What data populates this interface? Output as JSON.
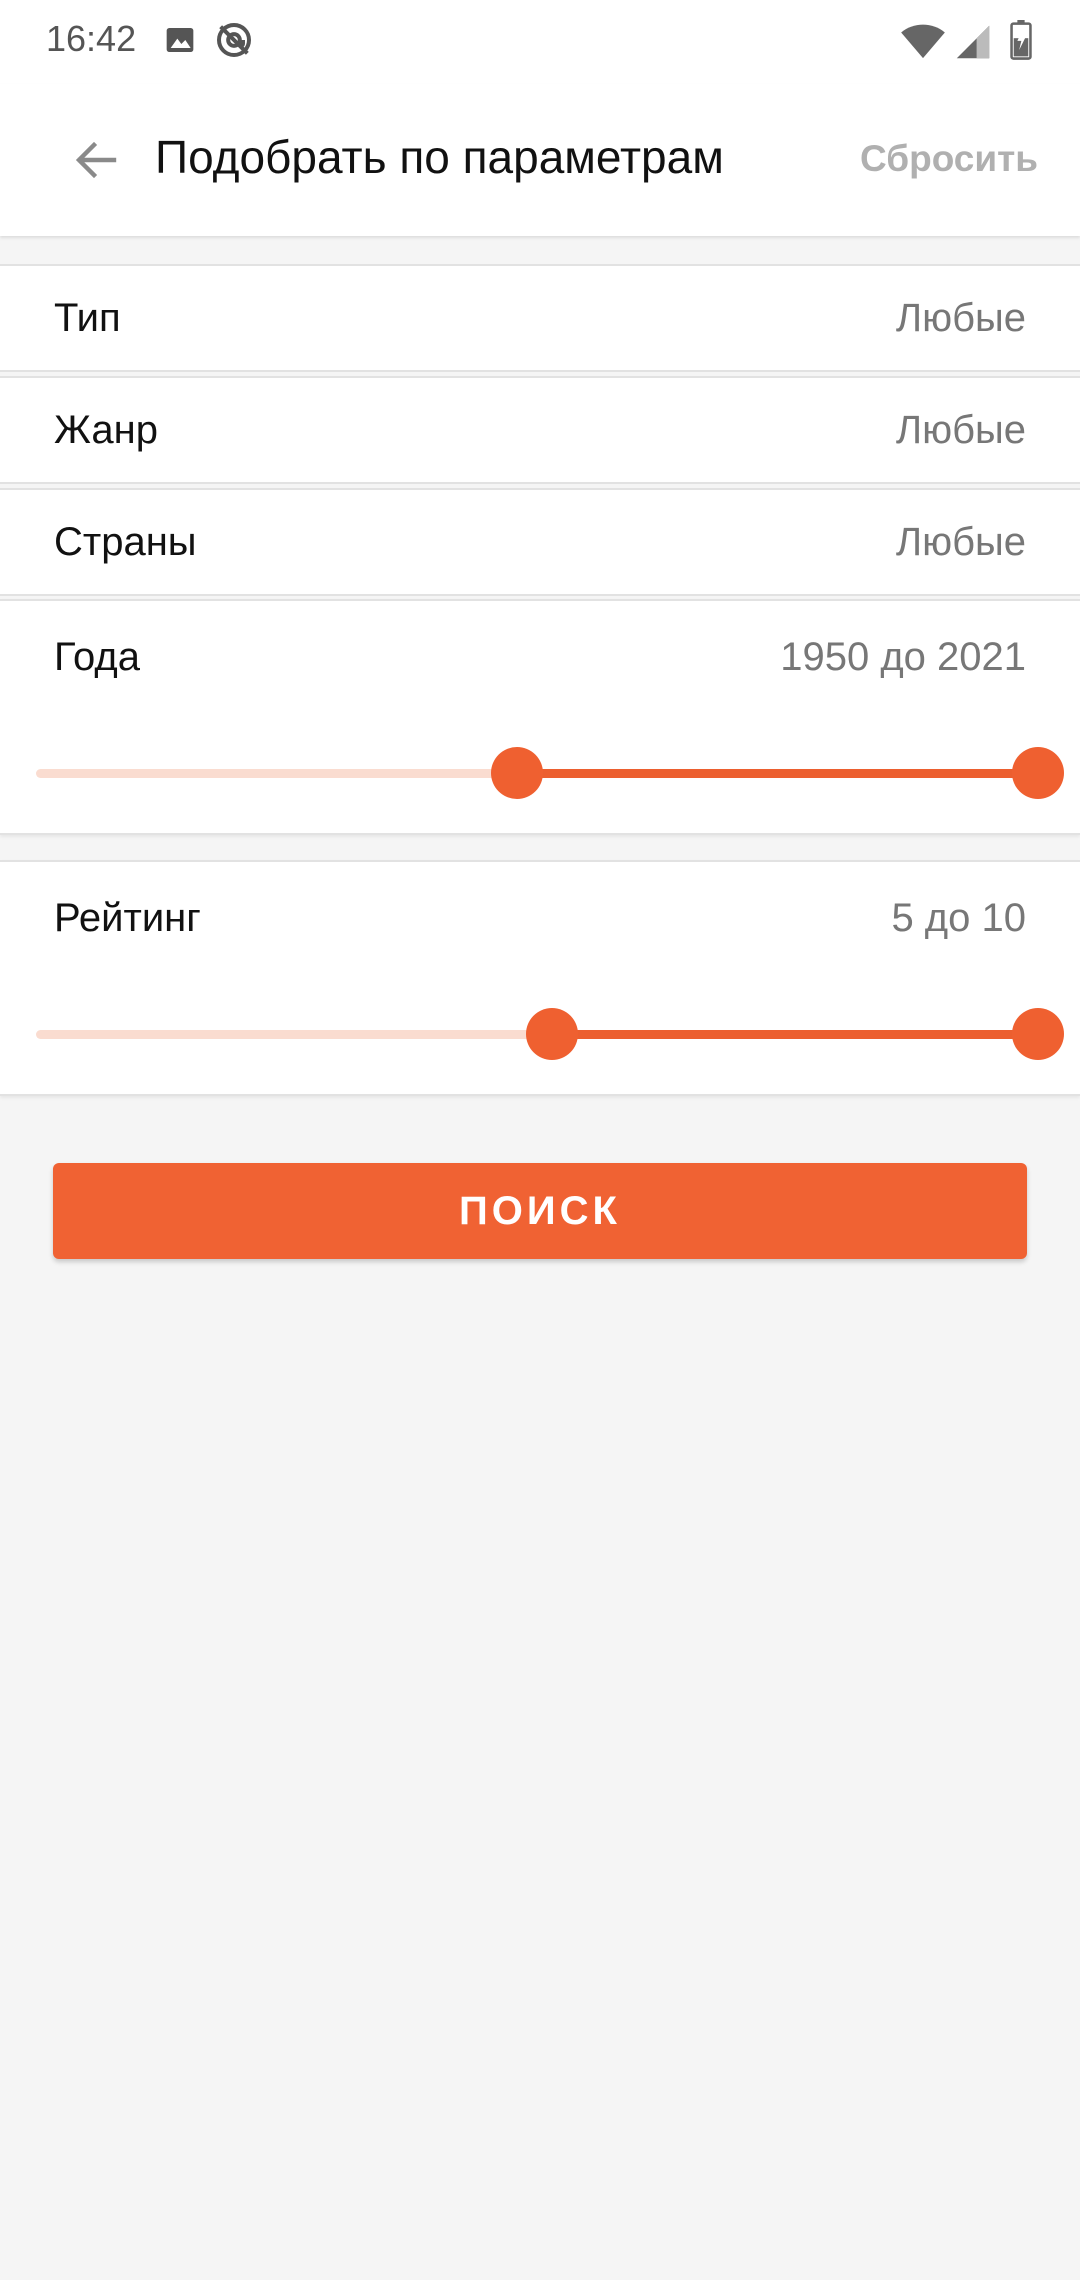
{
  "status_bar": {
    "time": "16:42",
    "icons": [
      "image-icon",
      "at-sign-icon",
      "wifi-icon",
      "signal-icon",
      "battery-icon"
    ]
  },
  "app_bar": {
    "back_icon": "arrow-left-icon",
    "title": "Подобрать по параметрам",
    "reset_label": "Сбросить"
  },
  "filters": {
    "type": {
      "label": "Тип",
      "value": "Любые"
    },
    "genre": {
      "label": "Жанр",
      "value": "Любые"
    },
    "countries": {
      "label": "Страны",
      "value": "Любые"
    }
  },
  "years": {
    "label": "Года",
    "value_text": "1950 до 2021",
    "range_low_fraction": 0.48,
    "range_high_fraction": 1.0
  },
  "rating": {
    "label": "Рейтинг",
    "value_text": "5 до 10",
    "range_low_fraction": 0.515,
    "range_high_fraction": 1.0
  },
  "search_button": {
    "label": "ПОИСК"
  },
  "colors": {
    "accent": "#f06233",
    "track_inactive": "#fadcd0",
    "background": "#f5f5f5",
    "muted_text": "#777777",
    "reset_text": "#b0b0b0"
  }
}
